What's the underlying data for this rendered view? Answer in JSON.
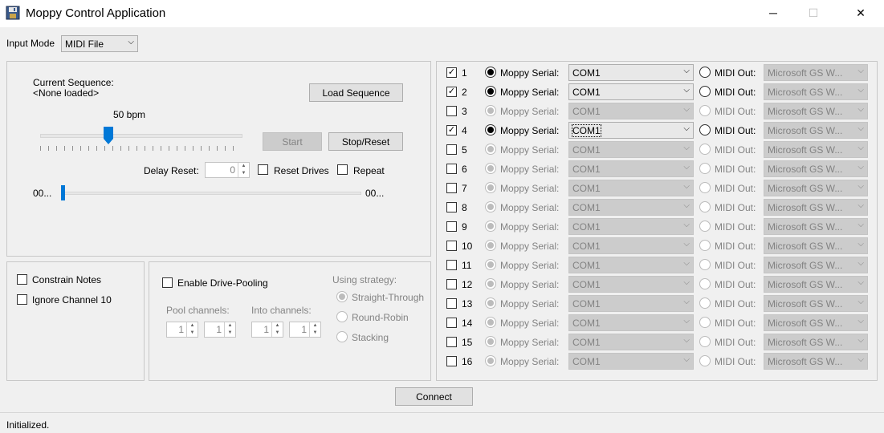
{
  "window": {
    "title": "Moppy Control Application",
    "minimize_glyph": "─",
    "maximize_glyph": "☐",
    "close_glyph": "✕",
    "app_icon": "moppy-floppy-icon"
  },
  "input_mode": {
    "label": "Input Mode",
    "value": "MIDI File"
  },
  "sequence": {
    "current_label": "Current Sequence:",
    "current_value": "<None loaded>",
    "load_button": "Load Sequence",
    "tempo_label": "50 bpm",
    "tempo_slider": {
      "min": 0,
      "max": 100,
      "value": 34
    },
    "start_button": "Start",
    "stop_button": "Stop/Reset",
    "delay_label": "Delay Reset:",
    "delay_value": "0",
    "reset_drives_label": "Reset Drives",
    "reset_drives_checked": false,
    "repeat_label": "Repeat",
    "repeat_checked": false,
    "position_start": "00...",
    "position_end": "00...",
    "position_slider": {
      "value": 0
    }
  },
  "options": {
    "constrain_notes": "Constrain Notes",
    "constrain_checked": false,
    "ignore_channel": "Ignore Channel 10",
    "ignore_checked": false
  },
  "pooling": {
    "enable_label": "Enable Drive-Pooling",
    "enable_checked": false,
    "strategy_label": "Using strategy:",
    "strategies": [
      "Straight-Through",
      "Round-Robin",
      "Stacking"
    ],
    "selected_strategy": 0,
    "pool_label": "Pool channels:",
    "into_label": "Into channels:",
    "pool_from": "1",
    "pool_to": "1",
    "into_from": "1",
    "into_to": "1"
  },
  "channels": [
    {
      "num": "1",
      "enabled": true,
      "serial_label": "Moppy Serial:",
      "serial": "COM1",
      "midi_label": "MIDI Out:",
      "midi": "Microsoft GS W..."
    },
    {
      "num": "2",
      "enabled": true,
      "serial_label": "Moppy Serial:",
      "serial": "COM1",
      "midi_label": "MIDI Out:",
      "midi": "Microsoft GS W..."
    },
    {
      "num": "3",
      "enabled": false,
      "serial_label": "Moppy Serial:",
      "serial": "COM1",
      "midi_label": "MIDI Out:",
      "midi": "Microsoft GS W..."
    },
    {
      "num": "4",
      "enabled": true,
      "focused": true,
      "serial_label": "Moppy Serial:",
      "serial": "COM1",
      "midi_label": "MIDI Out:",
      "midi": "Microsoft GS W..."
    },
    {
      "num": "5",
      "enabled": false,
      "serial_label": "Moppy Serial:",
      "serial": "COM1",
      "midi_label": "MIDI Out:",
      "midi": "Microsoft GS W..."
    },
    {
      "num": "6",
      "enabled": false,
      "serial_label": "Moppy Serial:",
      "serial": "COM1",
      "midi_label": "MIDI Out:",
      "midi": "Microsoft GS W..."
    },
    {
      "num": "7",
      "enabled": false,
      "serial_label": "Moppy Serial:",
      "serial": "COM1",
      "midi_label": "MIDI Out:",
      "midi": "Microsoft GS W..."
    },
    {
      "num": "8",
      "enabled": false,
      "serial_label": "Moppy Serial:",
      "serial": "COM1",
      "midi_label": "MIDI Out:",
      "midi": "Microsoft GS W..."
    },
    {
      "num": "9",
      "enabled": false,
      "serial_label": "Moppy Serial:",
      "serial": "COM1",
      "midi_label": "MIDI Out:",
      "midi": "Microsoft GS W..."
    },
    {
      "num": "10",
      "enabled": false,
      "serial_label": "Moppy Serial:",
      "serial": "COM1",
      "midi_label": "MIDI Out:",
      "midi": "Microsoft GS W..."
    },
    {
      "num": "11",
      "enabled": false,
      "serial_label": "Moppy Serial:",
      "serial": "COM1",
      "midi_label": "MIDI Out:",
      "midi": "Microsoft GS W..."
    },
    {
      "num": "12",
      "enabled": false,
      "serial_label": "Moppy Serial:",
      "serial": "COM1",
      "midi_label": "MIDI Out:",
      "midi": "Microsoft GS W..."
    },
    {
      "num": "13",
      "enabled": false,
      "serial_label": "Moppy Serial:",
      "serial": "COM1",
      "midi_label": "MIDI Out:",
      "midi": "Microsoft GS W..."
    },
    {
      "num": "14",
      "enabled": false,
      "serial_label": "Moppy Serial:",
      "serial": "COM1",
      "midi_label": "MIDI Out:",
      "midi": "Microsoft GS W..."
    },
    {
      "num": "15",
      "enabled": false,
      "serial_label": "Moppy Serial:",
      "serial": "COM1",
      "midi_label": "MIDI Out:",
      "midi": "Microsoft GS W..."
    },
    {
      "num": "16",
      "enabled": false,
      "serial_label": "Moppy Serial:",
      "serial": "COM1",
      "midi_label": "MIDI Out:",
      "midi": "Microsoft GS W..."
    }
  ],
  "connect_button": "Connect",
  "status": "Initialized."
}
